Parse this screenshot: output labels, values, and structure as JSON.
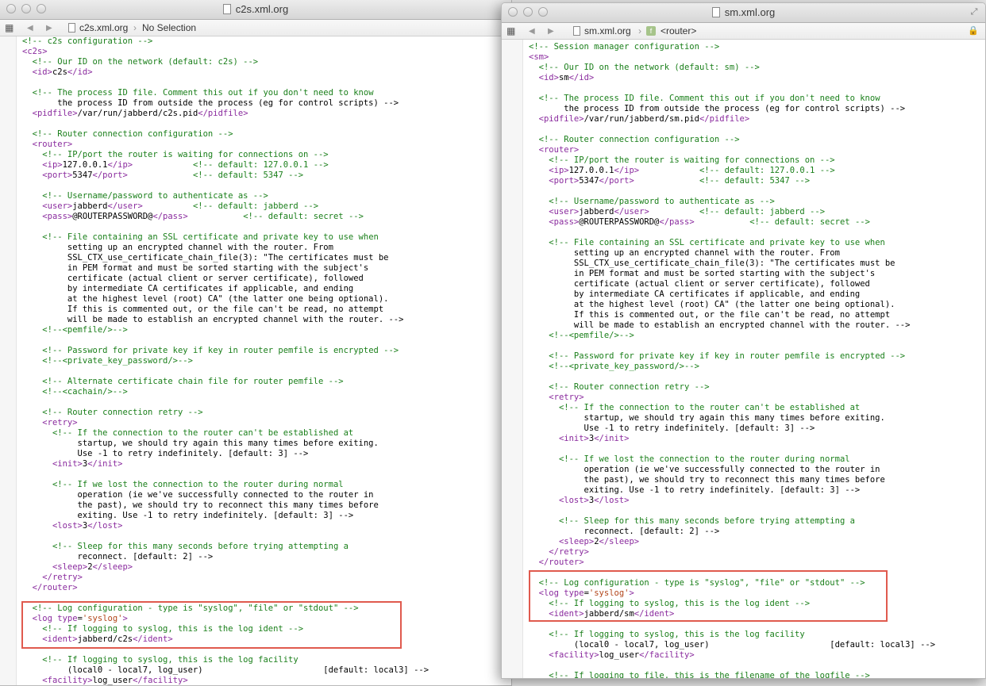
{
  "window_left": {
    "title": "c2s.xml.org",
    "jumpbar": {
      "file": "c2s.xml.org",
      "selection": "No Selection"
    },
    "code_lines": [
      "<!-- c2s configuration -->",
      "<c2s>",
      "  <!-- Our ID on the network (default: c2s) -->",
      "  <id>c2s</id>",
      "",
      "  <!-- The process ID file. Comment this out if you don't need to know",
      "       the process ID from outside the process (eg for control scripts) -->",
      "  <pidfile>/var/run/jabberd/c2s.pid</pidfile>",
      "",
      "  <!-- Router connection configuration -->",
      "  <router>",
      "    <!-- IP/port the router is waiting for connections on -->",
      "    <ip>127.0.0.1</ip>            <!-- default: 127.0.0.1 -->",
      "    <port>5347</port>             <!-- default: 5347 -->",
      "",
      "    <!-- Username/password to authenticate as -->",
      "    <user>jabberd</user>          <!-- default: jabberd -->",
      "    <pass>@ROUTERPASSWORD@</pass>           <!-- default: secret -->",
      "",
      "    <!-- File containing an SSL certificate and private key to use when",
      "         setting up an encrypted channel with the router. From",
      "         SSL_CTX_use_certificate_chain_file(3): \"The certificates must be",
      "         in PEM format and must be sorted starting with the subject's",
      "         certificate (actual client or server certificate), followed",
      "         by intermediate CA certificates if applicable, and ending",
      "         at the highest level (root) CA\" (the latter one being optional).",
      "         If this is commented out, or the file can't be read, no attempt",
      "         will be made to establish an encrypted channel with the router. -->",
      "    <!--<pemfile/>-->",
      "",
      "    <!-- Password for private key if key in router pemfile is encrypted -->",
      "    <!--<private_key_password/>-->",
      "",
      "    <!-- Alternate certificate chain file for router pemfile -->",
      "    <!--<cachain/>-->",
      "",
      "    <!-- Router connection retry -->",
      "    <retry>",
      "      <!-- If the connection to the router can't be established at",
      "           startup, we should try again this many times before exiting.",
      "           Use -1 to retry indefinitely. [default: 3] -->",
      "      <init>3</init>",
      "",
      "      <!-- If we lost the connection to the router during normal",
      "           operation (ie we've successfully connected to the router in",
      "           the past), we should try to reconnect this many times before",
      "           exiting. Use -1 to retry indefinitely. [default: 3] -->",
      "      <lost>3</lost>",
      "",
      "      <!-- Sleep for this many seconds before trying attempting a",
      "           reconnect. [default: 2] -->",
      "      <sleep>2</sleep>",
      "    </retry>",
      "  </router>",
      "",
      "  <!-- Log configuration - type is \"syslog\", \"file\" or \"stdout\" -->",
      "  <log type='syslog'>",
      "    <!-- If logging to syslog, this is the log ident -->",
      "    <ident>jabberd/c2s</ident>",
      "",
      "    <!-- If logging to syslog, this is the log facility",
      "         (local0 - local7, log_user)                        [default: local3] -->",
      "    <facility>log_user</facility>"
    ]
  },
  "window_right": {
    "title": "sm.xml.org",
    "jumpbar": {
      "file": "sm.xml.org",
      "selection": "<router>",
      "tag_icon": "f"
    },
    "code_lines": [
      "<!-- Session manager configuration -->",
      "<sm>",
      "  <!-- Our ID on the network (default: sm) -->",
      "  <id>sm</id>",
      "",
      "  <!-- The process ID file. Comment this out if you don't need to know",
      "       the process ID from outside the process (eg for control scripts) -->",
      "  <pidfile>/var/run/jabberd/sm.pid</pidfile>",
      "",
      "  <!-- Router connection configuration -->",
      "  <router>",
      "    <!-- IP/port the router is waiting for connections on -->",
      "    <ip>127.0.0.1</ip>            <!-- default: 127.0.0.1 -->",
      "    <port>5347</port>             <!-- default: 5347 -->",
      "",
      "    <!-- Username/password to authenticate as -->",
      "    <user>jabberd</user>          <!-- default: jabberd -->",
      "    <pass>@ROUTERPASSWORD@</pass>           <!-- default: secret -->",
      "",
      "    <!-- File containing an SSL certificate and private key to use when",
      "         setting up an encrypted channel with the router. From",
      "         SSL_CTX_use_certificate_chain_file(3): \"The certificates must be",
      "         in PEM format and must be sorted starting with the subject's",
      "         certificate (actual client or server certificate), followed",
      "         by intermediate CA certificates if applicable, and ending",
      "         at the highest level (root) CA\" (the latter one being optional).",
      "         If this is commented out, or the file can't be read, no attempt",
      "         will be made to establish an encrypted channel with the router. -->",
      "    <!--<pemfile/>-->",
      "",
      "    <!-- Password for private key if key in router pemfile is encrypted -->",
      "    <!--<private_key_password/>-->",
      "",
      "    <!-- Router connection retry -->",
      "    <retry>",
      "      <!-- If the connection to the router can't be established at",
      "           startup, we should try again this many times before exiting.",
      "           Use -1 to retry indefinitely. [default: 3] -->",
      "      <init>3</init>",
      "",
      "      <!-- If we lost the connection to the router during normal",
      "           operation (ie we've successfully connected to the router in",
      "           the past), we should try to reconnect this many times before",
      "           exiting. Use -1 to retry indefinitely. [default: 3] -->",
      "      <lost>3</lost>",
      "",
      "      <!-- Sleep for this many seconds before trying attempting a",
      "           reconnect. [default: 2] -->",
      "      <sleep>2</sleep>",
      "    </retry>",
      "  </router>",
      "",
      "  <!-- Log configuration - type is \"syslog\", \"file\" or \"stdout\" -->",
      "  <log type='syslog'>",
      "    <!-- If logging to syslog, this is the log ident -->",
      "    <ident>jabberd/sm</ident>",
      "",
      "    <!-- If logging to syslog, this is the log facility",
      "         (local0 - local7, log_user)                        [default: local3] -->",
      "    <facility>log_user</facility>",
      "",
      "    <!-- If logging to file, this is the filename of the logfile -->"
    ]
  },
  "colors": {
    "comment": "#1a7f1a",
    "tag": "#8a2b9e",
    "value": "#b2451a",
    "highlight_box": "#e05a4e"
  }
}
